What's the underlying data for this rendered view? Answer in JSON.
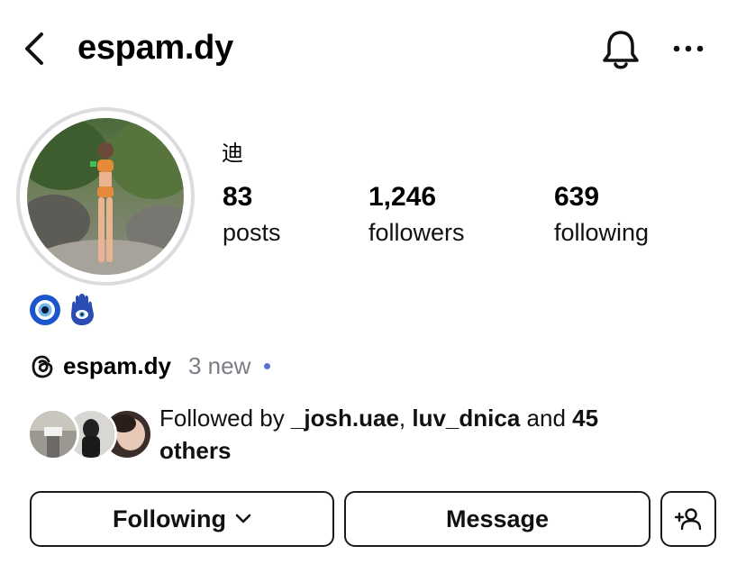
{
  "header": {
    "username": "espam.dy",
    "back_icon": "back-arrow-icon",
    "bell_icon": "bell-icon",
    "more_icon": "more-horizontal-icon"
  },
  "profile": {
    "display_name": "迪",
    "stats": [
      {
        "value": "83",
        "label": "posts"
      },
      {
        "value": "1,246",
        "label": "followers"
      },
      {
        "value": "639",
        "label": "following"
      }
    ],
    "bio_emojis": [
      "nazar-amulet",
      "hamsa"
    ]
  },
  "threads": {
    "name": "espam.dy",
    "new_label": "3 new",
    "dot_color": "#5a6fd6"
  },
  "followed_by": {
    "prefix": "Followed by ",
    "user1": "_josh.uae",
    "separator": ", ",
    "user2": "luv_dnica",
    "and_text": " and ",
    "others_count": "45",
    "others_label": "others"
  },
  "actions": {
    "following_label": "Following",
    "message_label": "Message",
    "add_person_icon": "add-person-icon"
  }
}
